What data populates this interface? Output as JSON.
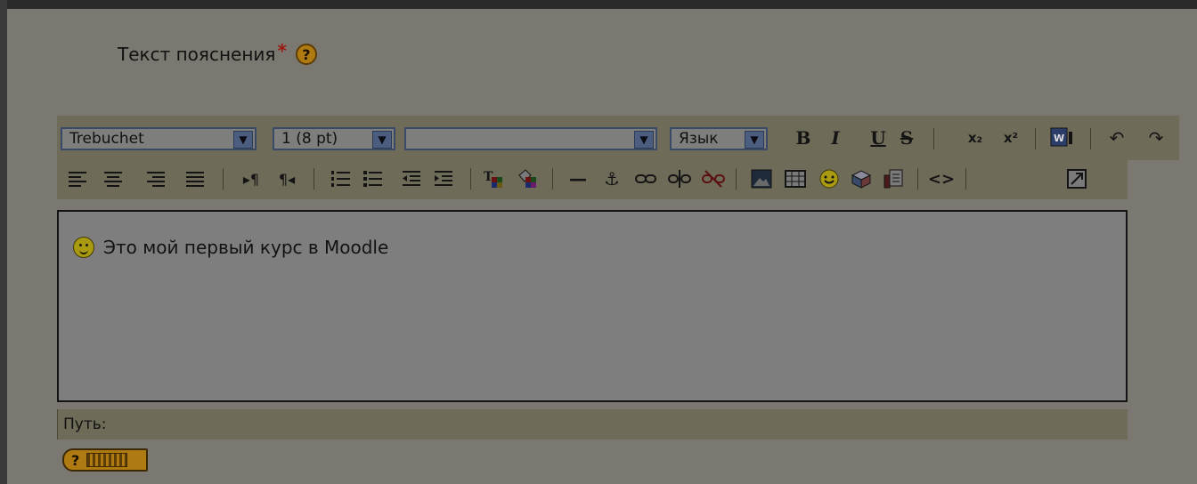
{
  "field": {
    "label": "Текст пояснения",
    "required_mark": "*",
    "help_glyph": "?"
  },
  "toolbar": {
    "font_family": "Trebuchet",
    "font_size": "1 (8 pt)",
    "format": "",
    "language": "Язык",
    "bold_glyph": "B",
    "italic_glyph": "I",
    "underline_glyph": "U",
    "strike_glyph": "S",
    "subscript_glyph": "x₂",
    "superscript_glyph": "x²",
    "word_glyph": "W",
    "undo_glyph": "↶",
    "redo_glyph": "↷",
    "ltr_glyph": "▸¶",
    "rtl_glyph": "¶◂",
    "hr_glyph": "—",
    "anchor_glyph": "⚓",
    "source_glyph": "<>",
    "icons": [
      "font-family-select",
      "font-size-select",
      "format-select",
      "language-select",
      "bold-icon",
      "italic-icon",
      "underline-icon",
      "strikethrough-icon",
      "subscript-icon",
      "superscript-icon",
      "paste-word-icon",
      "undo-icon",
      "redo-icon",
      "align-left-icon",
      "align-center-icon",
      "align-right-icon",
      "justify-icon",
      "ltr-icon",
      "rtl-icon",
      "ordered-list-icon",
      "unordered-list-icon",
      "outdent-icon",
      "indent-icon",
      "text-color-icon",
      "background-color-icon",
      "horizontal-rule-icon",
      "anchor-icon",
      "link-icon",
      "unlink-icon",
      "nolink-icon",
      "image-icon",
      "table-icon",
      "smiley-icon",
      "spellcheck-icon",
      "search-replace-icon",
      "html-source-icon",
      "fullscreen-icon"
    ]
  },
  "editor": {
    "content": "Это мой первый курс в Moodle"
  },
  "path_bar": {
    "label": "Путь:"
  },
  "keyboard_help": {
    "glyph": "?"
  }
}
